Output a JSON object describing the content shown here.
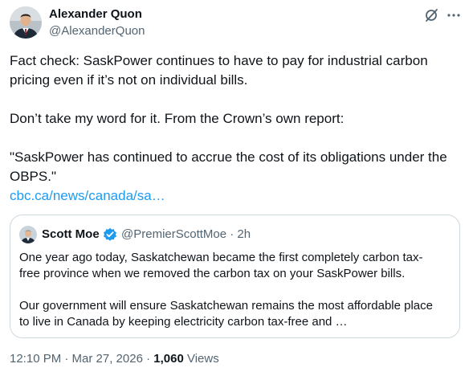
{
  "author": {
    "name": "Alexander Quon",
    "handle": "@AlexanderQuon"
  },
  "tweet": {
    "lines": [
      "Fact check: SaskPower continues to have to pay for industrial carbon",
      "pricing even if it’s not on individual bills.",
      "Don’t take my word for it. From the Crown’s own report:",
      "\"SaskPower has continued to accrue the cost of its obligations under the",
      "OBPS.\""
    ],
    "link": "cbc.ca/news/canada/sa…"
  },
  "quote": {
    "name": "Scott Moe",
    "handle_time": "@PremierScottMoe · 2h",
    "lines": [
      "One year ago today, Saskatchewan became the first completely carbon tax-",
      "free province when we removed the carbon tax on your SaskPower bills.",
      "Our government will ensure Saskatchewan remains the most affordable place",
      "to live in Canada by keeping electricity carbon tax-free and …"
    ]
  },
  "footer": {
    "timestamp": "12:10 PM · Mar 27, 2026 · ",
    "views_count": "1,060",
    "views_label": " Views"
  },
  "icons": {
    "grok": "grok-icon",
    "more": "more-icon",
    "verified": "verified-badge-icon"
  },
  "colors": {
    "link": "#1d9bf0",
    "secondary_text": "#536471",
    "border": "#cfd9de"
  }
}
